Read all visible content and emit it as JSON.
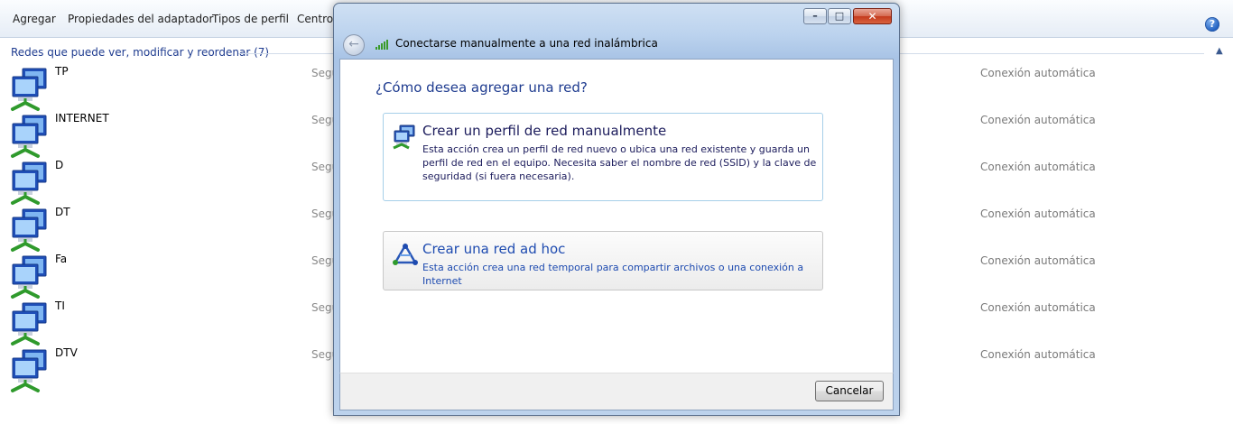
{
  "toolbar": {
    "items": [
      "Agregar",
      "Propiedades del adaptador",
      "Tipos de perfil",
      "Centro"
    ],
    "help_icon": "help-icon"
  },
  "group": {
    "header": "Redes que puede ver, modificar y reordenar (7)"
  },
  "networks": [
    {
      "name": "TP",
      "security": "Segu",
      "mode": "Conexión automática"
    },
    {
      "name": "INTERNET",
      "security": "Segu",
      "mode": "Conexión automática"
    },
    {
      "name": "D",
      "security": "Segu",
      "mode": "Conexión automática"
    },
    {
      "name": "DT",
      "security": "Segu",
      "mode": "Conexión automática"
    },
    {
      "name": "Fa",
      "security": "Segu",
      "mode": "Conexión automática"
    },
    {
      "name": "TI",
      "security": "Segu",
      "mode": "Conexión automática"
    },
    {
      "name": "DTV",
      "security": "Segu",
      "mode": "Conexión automática"
    }
  ],
  "dialog": {
    "title": "Conectarse manualmente a una red inalámbrica",
    "question": "¿Cómo desea agregar una red?",
    "options": [
      {
        "title": "Crear un perfil de red manualmente",
        "description": "Esta acción crea un perfil de red nuevo o ubica una red existente y guarda un perfil de red en el equipo. Necesita saber el nombre de red (SSID) y la clave de seguridad (si fuera necesaria).",
        "icon": "network-computers-icon"
      },
      {
        "title": "Crear una red ad hoc",
        "description": "Esta acción crea una red temporal para compartir archivos o una conexión a Internet",
        "icon": "adhoc-network-icon"
      }
    ],
    "cancel_label": "Cancelar",
    "window_buttons": {
      "minimize": "–",
      "maximize": "□",
      "close": "✕"
    },
    "back_glyph": "←"
  },
  "colors": {
    "link_blue": "#1e3b8f",
    "option_blue": "#1e4bb0",
    "muted_text": "#7a7a7a"
  }
}
